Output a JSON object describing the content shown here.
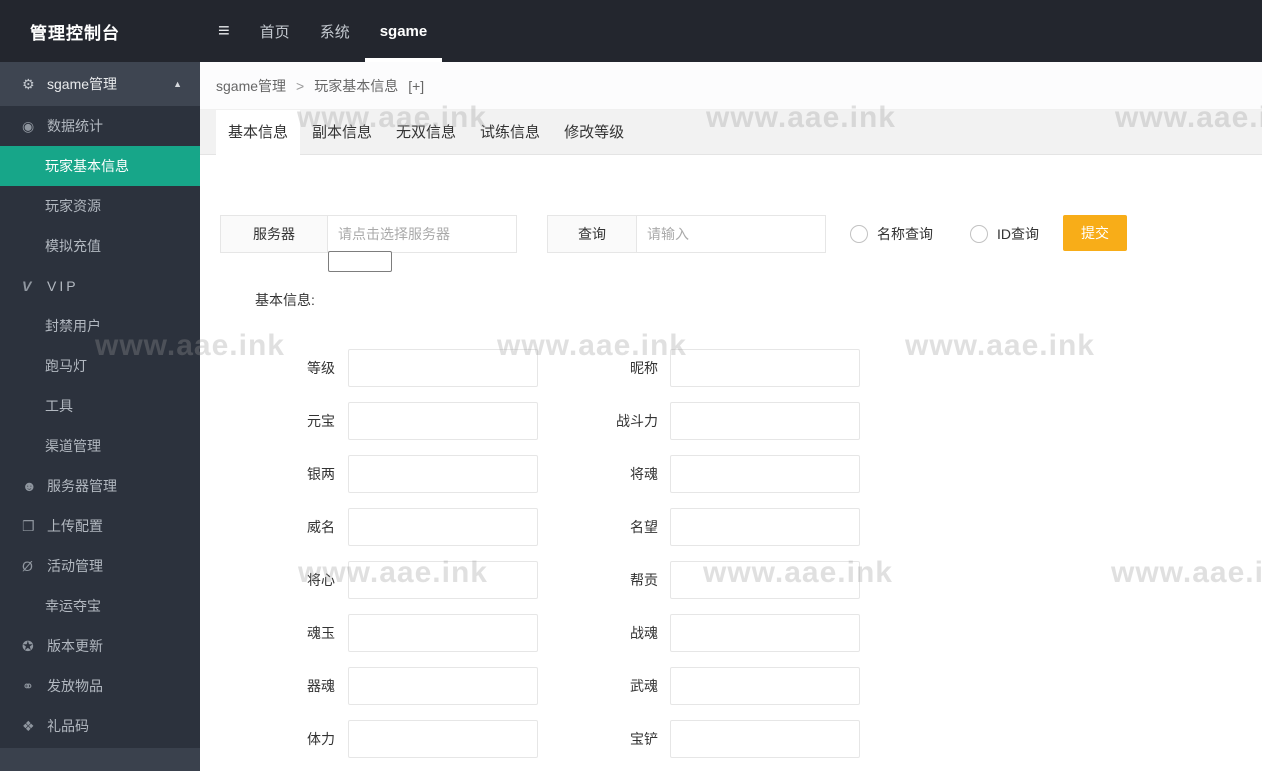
{
  "topbar": {
    "title": "管理控制台",
    "menu_icon": "hamburger-icon",
    "nav": [
      {
        "label": "首页",
        "active": false
      },
      {
        "label": "系统",
        "active": false
      },
      {
        "label": "sgame",
        "active": true
      }
    ]
  },
  "sidebar": {
    "header": {
      "label": "sgame管理",
      "icon": "gear-icon",
      "glyph": "⚙",
      "caret": "▲"
    },
    "items": [
      {
        "label": "数据统计",
        "level": 1,
        "icon": "stats-icon",
        "glyph": "◉",
        "active": false
      },
      {
        "label": "玩家基本信息",
        "level": 2,
        "active": true
      },
      {
        "label": "玩家资源",
        "level": 2,
        "active": false
      },
      {
        "label": "模拟充值",
        "level": 2,
        "active": false
      },
      {
        "label": "VIP",
        "level": 1,
        "icon": "vip-icon",
        "glyph": "V",
        "active": false
      },
      {
        "label": "封禁用户",
        "level": 2,
        "active": false
      },
      {
        "label": "跑马灯",
        "level": 2,
        "active": false
      },
      {
        "label": "工具",
        "level": 2,
        "active": false
      },
      {
        "label": "渠道管理",
        "level": 2,
        "active": false
      },
      {
        "label": "服务器管理",
        "level": 1,
        "icon": "server-icon",
        "glyph": "☻",
        "active": false
      },
      {
        "label": "上传配置",
        "level": 1,
        "icon": "upload-icon",
        "glyph": "❒",
        "active": false
      },
      {
        "label": "活动管理",
        "level": 1,
        "icon": "activity-icon",
        "glyph": "Ø",
        "active": false
      },
      {
        "label": "幸运夺宝",
        "level": 2,
        "active": false
      },
      {
        "label": "版本更新",
        "level": 1,
        "icon": "version-icon",
        "glyph": "✪",
        "active": false
      },
      {
        "label": "发放物品",
        "level": 1,
        "icon": "link-icon",
        "glyph": "⚭",
        "active": false
      },
      {
        "label": "礼品码",
        "level": 1,
        "icon": "giftcode-icon",
        "glyph": "❖",
        "active": false
      }
    ]
  },
  "breadcrumb": {
    "parent": "sgame管理",
    "sep": ">",
    "current": "玩家基本信息",
    "add": "[+]"
  },
  "tabs": [
    {
      "label": "基本信息",
      "active": true
    },
    {
      "label": "副本信息",
      "active": false
    },
    {
      "label": "无双信息",
      "active": false
    },
    {
      "label": "试练信息",
      "active": false
    },
    {
      "label": "修改等级",
      "active": false
    }
  ],
  "query": {
    "server_label": "服务器",
    "server_placeholder": "请点击选择服务器",
    "query_label": "查询",
    "query_placeholder": "请输入",
    "radios": [
      {
        "label": "名称查询",
        "checked": false
      },
      {
        "label": "ID查询",
        "checked": false
      }
    ],
    "submit_label": "提交"
  },
  "section_title": "基本信息:",
  "form": {
    "rows": [
      {
        "left": "等级",
        "right": "昵称"
      },
      {
        "left": "元宝",
        "right": "战斗力"
      },
      {
        "left": "银两",
        "right": "将魂"
      },
      {
        "left": "威名",
        "right": "名望"
      },
      {
        "left": "将心",
        "right": "帮贡"
      },
      {
        "left": "魂玉",
        "right": "战魂"
      },
      {
        "left": "器魂",
        "right": "武魂"
      },
      {
        "left": "体力",
        "right": "宝铲"
      }
    ]
  },
  "watermark": {
    "text": "www.aae.ink"
  },
  "colors": {
    "topbar_bg": "#23262e",
    "sidebar_bg": "#2c323d",
    "sidebar_header_bg": "#3e4551",
    "active_item_teal": "#17a689",
    "submit_orange": "#f8ad18",
    "tabstrip_bg": "#f2f2f2"
  }
}
